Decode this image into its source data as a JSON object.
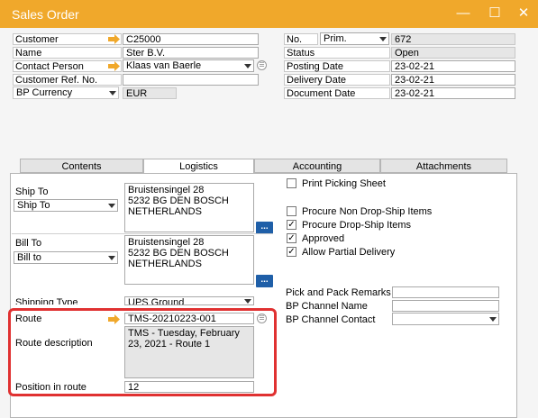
{
  "window": {
    "title": "Sales Order",
    "controls": {
      "close": "✕",
      "maximize": "☐",
      "minimize": "—"
    }
  },
  "header_left": {
    "customer_label": "Customer",
    "customer_value": "C25000",
    "name_label": "Name",
    "name_value": "Ster B.V.",
    "contact_label": "Contact Person",
    "contact_value": "Klaas van Baerle",
    "ref_label": "Customer Ref. No.",
    "ref_value": "",
    "currency_label": "BP Currency",
    "currency_value": "EUR"
  },
  "header_right": {
    "no_label": "No.",
    "series_value": "Prim.",
    "no_value": "672",
    "status_label": "Status",
    "status_value": "Open",
    "posting_label": "Posting Date",
    "posting_value": "23-02-21",
    "delivery_label": "Delivery Date",
    "delivery_value": "23-02-21",
    "document_label": "Document Date",
    "document_value": "23-02-21"
  },
  "tabs": [
    {
      "label": "Contents",
      "active": false
    },
    {
      "label": "Logistics",
      "active": true
    },
    {
      "label": "Accounting",
      "active": false
    },
    {
      "label": "Attachments",
      "active": false
    }
  ],
  "logistics": {
    "ship_to_label": "Ship To",
    "ship_to_select": "Ship To",
    "ship_to_address": "Bruistensingel 28\n5232 BG  DEN BOSCH\nNETHERLANDS",
    "bill_to_label": "Bill To",
    "bill_to_select": "Bill to",
    "bill_to_address": "Bruistensingel 28\n5232 BG  DEN BOSCH\nNETHERLANDS",
    "dots_label": "...",
    "shipping_type_label": "Shipping Type",
    "shipping_type_value": "UPS Ground",
    "route_label": "Route",
    "route_value": "TMS-20210223-001",
    "route_desc_label": "Route description",
    "route_desc_value": "TMS - Tuesday, February 23, 2021 - Route 1",
    "position_label": "Position in route",
    "position_value": "12",
    "checkboxes": {
      "print_picking": {
        "label": "Print Picking Sheet",
        "checked": false
      },
      "procure_non_drop": {
        "label": "Procure Non Drop-Ship Items",
        "checked": false
      },
      "procure_drop": {
        "label": "Procure Drop-Ship Items",
        "checked": true
      },
      "approved": {
        "label": "Approved",
        "checked": true
      },
      "partial": {
        "label": "Allow Partial Delivery",
        "checked": true
      }
    },
    "pick_remarks_label": "Pick and Pack Remarks",
    "pick_remarks_value": "",
    "channel_name_label": "BP Channel Name",
    "channel_name_value": "",
    "channel_contact_label": "BP Channel Contact",
    "channel_contact_value": "",
    "check_mark": "✓"
  },
  "colors": {
    "titlebar": "#f0a82b",
    "highlight": "#e03131",
    "link_arrow": "#f0a82b",
    "dots_button": "#1f5fa8"
  }
}
